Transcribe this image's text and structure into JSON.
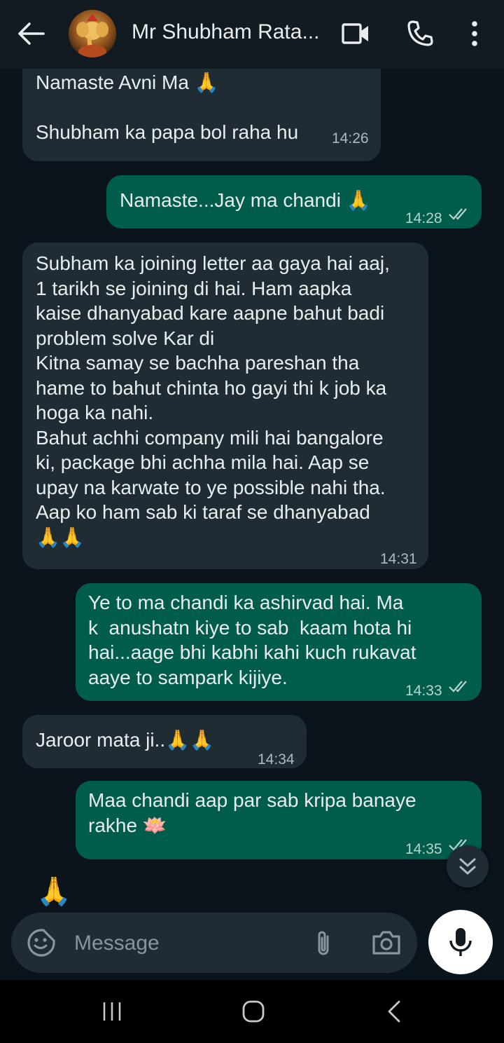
{
  "header": {
    "title": "Mr Shubham Rata...",
    "avatar_icon": "ganesha-avatar",
    "icons": [
      "back-arrow-icon",
      "video-call-icon",
      "phone-icon",
      "more-vert-icon"
    ]
  },
  "messages": [
    {
      "dir": "in",
      "text": "Namaste Avni Ma 🙏\n\nShubham ka papa bol raha hu",
      "time": "14:26"
    },
    {
      "dir": "out",
      "text": "Namaste...Jay ma chandi 🙏",
      "time": "14:28"
    },
    {
      "dir": "in",
      "text": "Subham ka joining letter aa gaya hai aaj,\n1 tarikh se joining di hai. Ham aapka\nkaise dhanyabad kare aapne bahut badi\nproblem solve Kar di\nKitna samay se bachha pareshan tha\nhame to bahut chinta ho gayi thi k job ka\nhoga ka nahi.\nBahut achhi company mili hai bangalore\nki, package bhi achha mila hai. Aap se\nupay na karwate to ye possible nahi tha.\nAap ko ham sab ki taraf se dhanyabad\n🙏🙏",
      "time": "14:31"
    },
    {
      "dir": "out",
      "text": "Ye to ma chandi ka ashirvad hai. Ma\nk  anushatn kiye to sab  kaam hota hi\nhai...aage bhi kabhi kahi kuch rukavat\naaye to sampark kijiye.",
      "time": "14:33"
    },
    {
      "dir": "in",
      "text": "Jaroor mata ji..🙏🙏",
      "time": "14:34"
    },
    {
      "dir": "out",
      "text": "Maa chandi aap par sab kripa banaye\nrakhe 🪷",
      "time": "14:35"
    },
    {
      "dir": "in",
      "text": "🙏",
      "time": ""
    }
  ],
  "input": {
    "placeholder": "Message"
  },
  "colors": {
    "background": "#0b141a",
    "incoming": "#202c33",
    "outgoing": "#005c4b",
    "read_ticks": "#b6d4cc"
  }
}
